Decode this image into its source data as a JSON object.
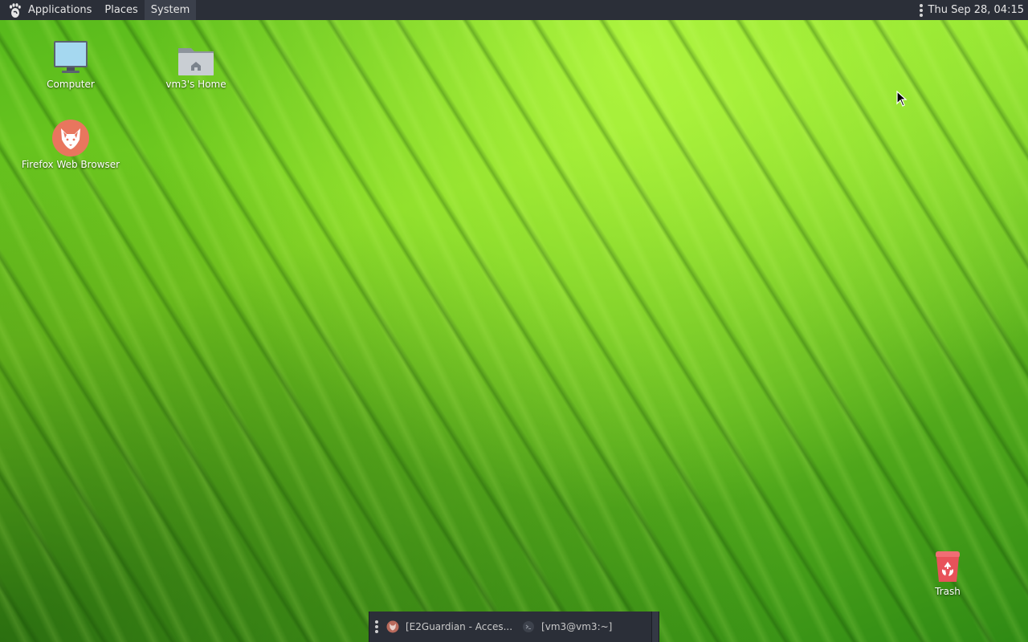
{
  "top_panel": {
    "menus": [
      "Applications",
      "Places",
      "System"
    ],
    "clock": "Thu Sep 28, 04:15",
    "logo_icon": "gnome-foot-icon"
  },
  "desktop": {
    "icons": {
      "computer": {
        "label": "Computer",
        "icon": "computer-monitor-icon"
      },
      "home": {
        "label": "vm3's Home",
        "icon": "home-folder-icon"
      },
      "firefox": {
        "label": "Firefox Web Browser",
        "icon": "firefox-fox-icon"
      },
      "trash": {
        "label": "Trash",
        "icon": "trash-bin-icon"
      }
    },
    "wallpaper": "green-leaf",
    "accent_colors": {
      "panel": "#2b2f38",
      "firefox": "#e8765e",
      "trash": "#e8525a",
      "monitor": "#a5d8f0"
    }
  },
  "taskbar": {
    "tasks": [
      {
        "label": "[E2Guardian - Acces...",
        "icon": "firefox-fox-icon"
      },
      {
        "label": "[vm3@vm3:~]",
        "icon": "terminal-icon"
      }
    ]
  }
}
